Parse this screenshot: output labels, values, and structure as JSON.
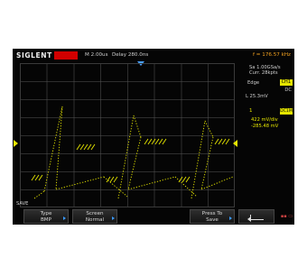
{
  "header": {
    "brand": "SIGLENT",
    "timebase": "M 2.00us",
    "delay": "Delay 280.0ns",
    "frequency": "f = 176.57 kHz"
  },
  "acquisition": {
    "sample_rate": "Sa 1.00GSa/s",
    "memory": "Curr. 28kpts"
  },
  "trigger": {
    "type": "Edge",
    "source": "CH1",
    "coupling": "DC",
    "level": "L 25.3mV"
  },
  "channel1": {
    "number": "1",
    "badge": "DC1M",
    "scale": "422 mV/div",
    "offset": "-285.48 mV"
  },
  "status": {
    "save_label": "SAVE"
  },
  "softkeys": [
    {
      "line1": "Type",
      "line2": "BMP"
    },
    {
      "line1": "Screen",
      "line2": "Normal"
    },
    {
      "line1": "Press To",
      "line2": "Save"
    }
  ],
  "colors": {
    "background": "#050505",
    "trace": "#e6e600",
    "run_indicator": "#d10000",
    "trigger_marker": "#4aa0ff",
    "frequency_text": "#f0a020"
  },
  "icons": {
    "return": "return-arrow-icon",
    "trigger_edge": "rising-edge-icon",
    "tray": "status-tray-icons"
  }
}
